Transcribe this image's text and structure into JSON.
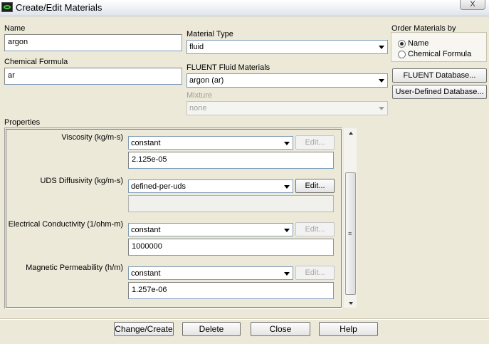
{
  "window": {
    "title": "Create/Edit Materials",
    "close_label": "X"
  },
  "name": {
    "label": "Name",
    "value": "argon"
  },
  "chemical_formula": {
    "label": "Chemical Formula",
    "value": "ar"
  },
  "material_type": {
    "label": "Material Type",
    "value": "fluid"
  },
  "fluent_fluid_materials": {
    "label": "FLUENT Fluid Materials",
    "value": "argon (ar)"
  },
  "mixture": {
    "label": "Mixture",
    "value": "none"
  },
  "order_by": {
    "label": "Order Materials by",
    "options": [
      {
        "label": "Name",
        "selected": true
      },
      {
        "label": "Chemical Formula",
        "selected": false
      }
    ]
  },
  "database_buttons": {
    "fluent": "FLUENT Database...",
    "user_defined": "User-Defined Database..."
  },
  "properties": {
    "label": "Properties",
    "rows": [
      {
        "label": "Viscosity (kg/m-s)",
        "method": "constant",
        "value": "2.125e-05",
        "edit": "Edit...",
        "edit_enabled": false
      },
      {
        "label": "UDS Diffusivity (kg/m-s)",
        "method": "defined-per-uds",
        "value": "",
        "edit": "Edit...",
        "edit_enabled": true
      },
      {
        "label": "Electrical Conductivity (1/ohm-m)",
        "method": "constant",
        "value": "1000000",
        "edit": "Edit...",
        "edit_enabled": false
      },
      {
        "label": "Magnetic Permeability (h/m)",
        "method": "constant",
        "value": "1.257e-06",
        "edit": "Edit...",
        "edit_enabled": false
      }
    ]
  },
  "footer": {
    "change_create": "Change/Create",
    "delete": "Delete",
    "close": "Close",
    "help": "Help"
  },
  "icons": [
    "app-icon",
    "scroll-up-icon",
    "scroll-down-icon",
    "scroll-grip-icon",
    "chevron-down-icon"
  ]
}
